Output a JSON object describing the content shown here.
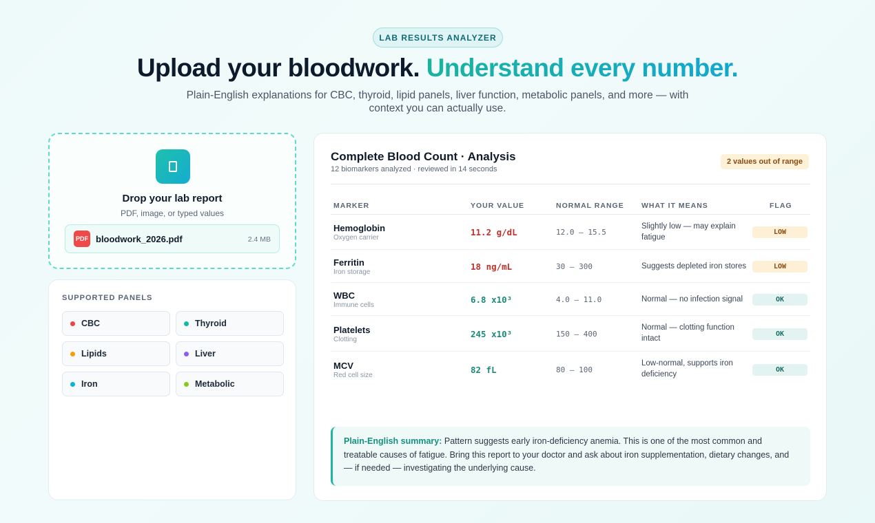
{
  "header": {
    "badge": "LAB RESULTS ANALYZER",
    "title_dark": "Upload your bloodwork.",
    "title_accent": "Understand every number.",
    "subtitle": "Plain-English explanations for CBC, thyroid, lipid panels, liver function, metabolic panels, and more — with context you can actually use."
  },
  "upload": {
    "icon": "document-icon",
    "title": "Drop your lab report",
    "subtitle": "PDF, image, or typed values",
    "file": {
      "type_label": "PDF",
      "name": "bloodwork_2026.pdf",
      "size": "2.4 MB"
    }
  },
  "panels": {
    "title": "SUPPORTED PANELS",
    "items": [
      {
        "label": "CBC",
        "color": "#ef4444"
      },
      {
        "label": "Thyroid",
        "color": "#14b8a6"
      },
      {
        "label": "Lipids",
        "color": "#f59e0b"
      },
      {
        "label": "Liver",
        "color": "#8b5cf6"
      },
      {
        "label": "Iron",
        "color": "#06b6d4"
      },
      {
        "label": "Metabolic",
        "color": "#84cc16"
      }
    ]
  },
  "analysis": {
    "title": "Complete Blood Count · Analysis",
    "subtitle": "12 biomarkers analyzed · reviewed in 14 seconds",
    "flag_summary": "2 values out of range",
    "columns": [
      "MARKER",
      "YOUR VALUE",
      "NORMAL RANGE",
      "WHAT IT MEANS",
      "FLAG"
    ],
    "rows": [
      {
        "marker": "Hemoglobin",
        "sub": "Oxygen carrier",
        "value": "11.2 g/dL",
        "range": "12.0 – 15.5",
        "meaning": "Slightly low — may explain fatigue",
        "flag": "LOW"
      },
      {
        "marker": "Ferritin",
        "sub": "Iron storage",
        "value": "18 ng/mL",
        "range": "30 – 300",
        "meaning": "Suggests depleted iron stores",
        "flag": "LOW"
      },
      {
        "marker": "WBC",
        "sub": "Immune cells",
        "value": "6.8 x10³",
        "range": "4.0 – 11.0",
        "meaning": "Normal — no infection signal",
        "flag": "OK"
      },
      {
        "marker": "Platelets",
        "sub": "Clotting",
        "value": "245 x10³",
        "range": "150 – 400",
        "meaning": "Normal — clotting function intact",
        "flag": "OK"
      },
      {
        "marker": "MCV",
        "sub": "Red cell size",
        "value": "82 fL",
        "range": "80 – 100",
        "meaning": "Low-normal, supports iron deficiency",
        "flag": "OK"
      }
    ],
    "summary_label": "Plain-English summary:",
    "summary_text": "Pattern suggests early iron-deficiency anemia. This is one of the most common and treatable causes of fatigue. Bring this report to your doctor and ask about iron supplementation, dietary changes, and — if needed — investigating the underlying cause."
  }
}
